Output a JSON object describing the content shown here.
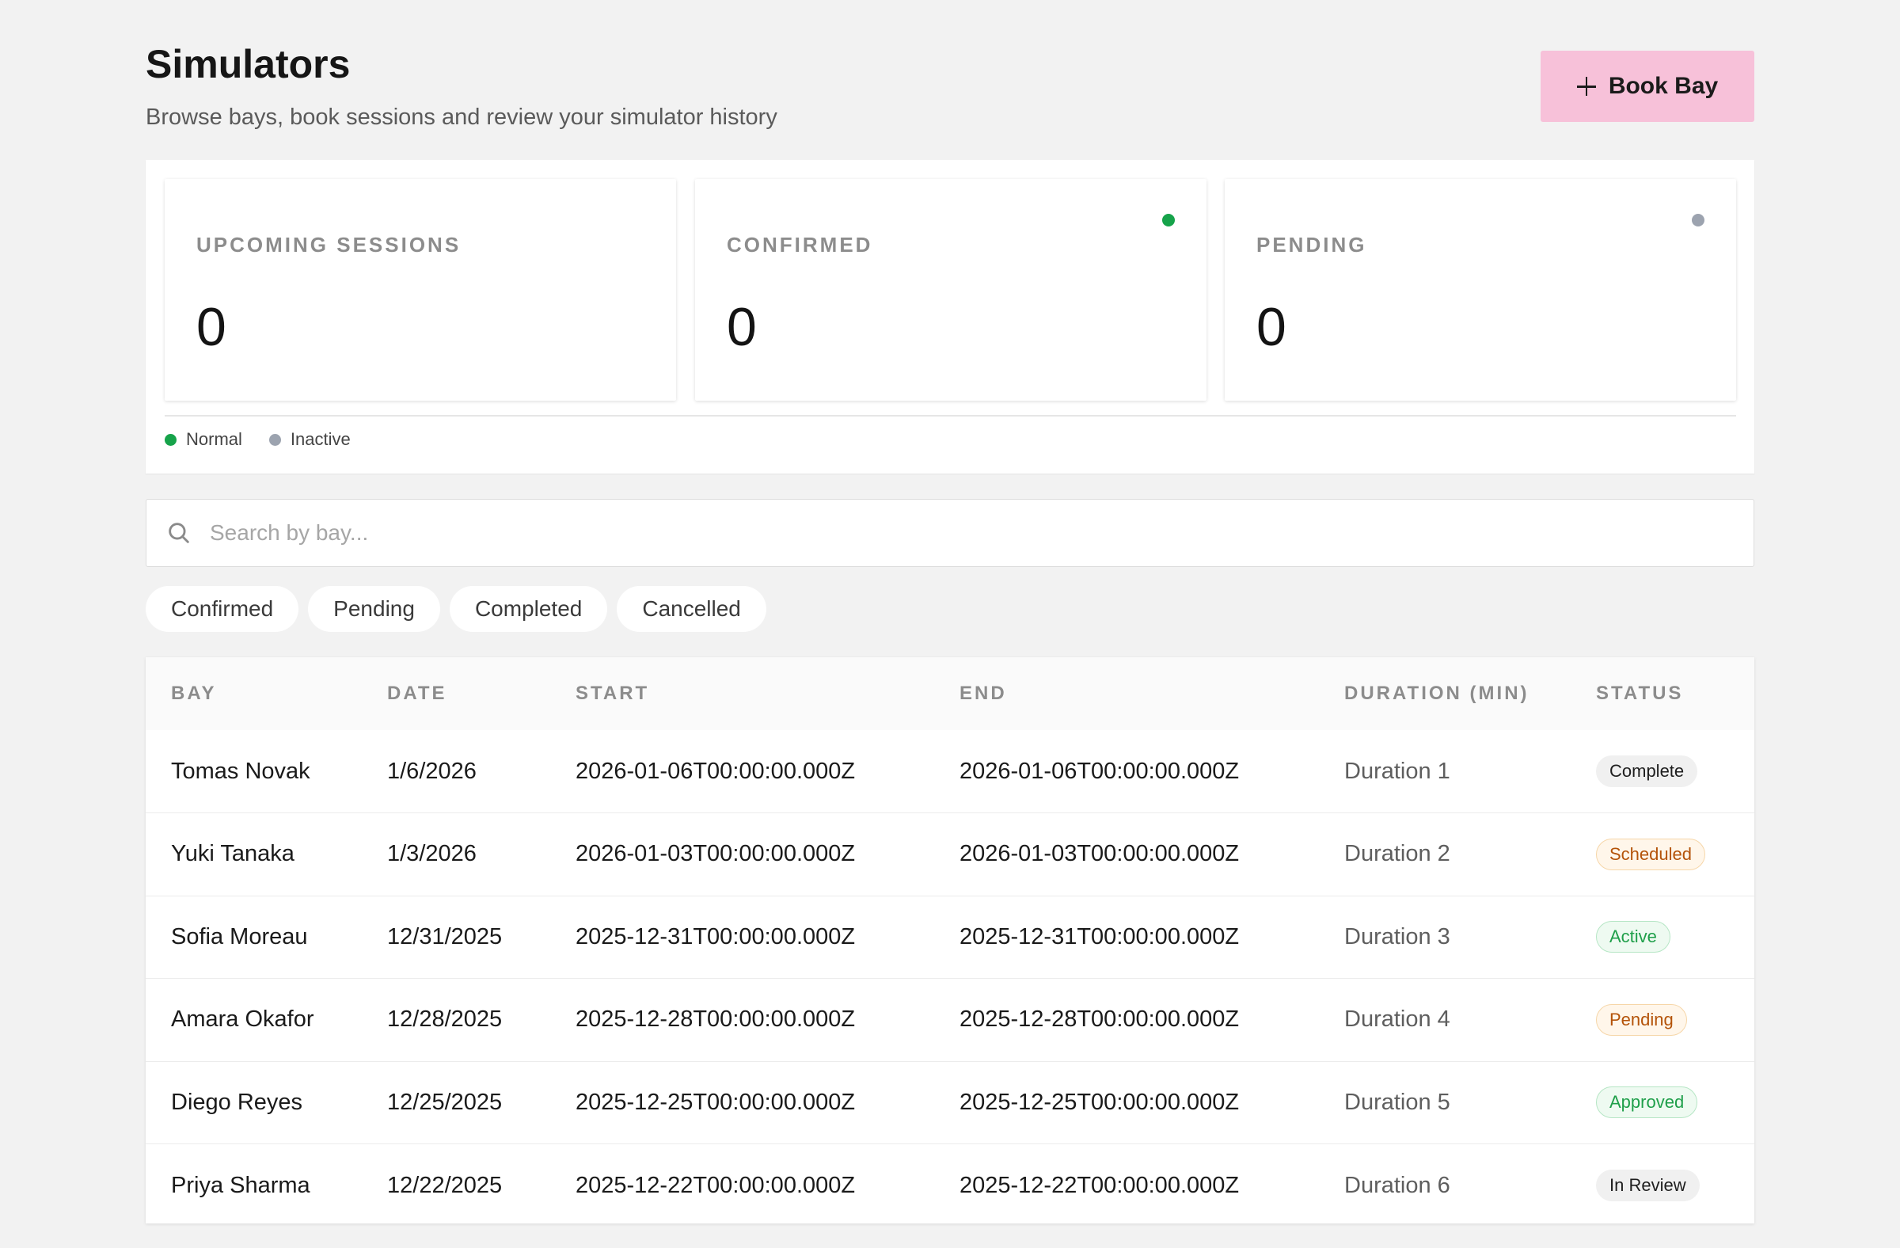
{
  "header": {
    "title": "Simulators",
    "subtitle": "Browse bays, book sessions and review your simulator history",
    "book_label": "Book Bay"
  },
  "stats": [
    {
      "label": "UPCOMING SESSIONS",
      "value": "0",
      "dot_color": ""
    },
    {
      "label": "CONFIRMED",
      "value": "0",
      "dot_color": "#16a34a"
    },
    {
      "label": "PENDING",
      "value": "0",
      "dot_color": "#9ca3af"
    }
  ],
  "legend": [
    {
      "label": "Normal",
      "color": "#16a34a"
    },
    {
      "label": "Inactive",
      "color": "#9ca3af"
    }
  ],
  "search": {
    "placeholder": "Search by bay..."
  },
  "filters": [
    "Confirmed",
    "Pending",
    "Completed",
    "Cancelled"
  ],
  "table": {
    "columns": [
      "BAY",
      "DATE",
      "START",
      "END",
      "DURATION (MIN)",
      "STATUS"
    ],
    "rows": [
      {
        "bay": "Tomas Novak",
        "date": "1/6/2026",
        "start": "2026-01-06T00:00:00.000Z",
        "end": "2026-01-06T00:00:00.000Z",
        "duration": "Duration 1",
        "status": "Complete",
        "status_style": "neutral"
      },
      {
        "bay": "Yuki Tanaka",
        "date": "1/3/2026",
        "start": "2026-01-03T00:00:00.000Z",
        "end": "2026-01-03T00:00:00.000Z",
        "duration": "Duration 2",
        "status": "Scheduled",
        "status_style": "warn"
      },
      {
        "bay": "Sofia Moreau",
        "date": "12/31/2025",
        "start": "2025-12-31T00:00:00.000Z",
        "end": "2025-12-31T00:00:00.000Z",
        "duration": "Duration 3",
        "status": "Active",
        "status_style": "success"
      },
      {
        "bay": "Amara Okafor",
        "date": "12/28/2025",
        "start": "2025-12-28T00:00:00.000Z",
        "end": "2025-12-28T00:00:00.000Z",
        "duration": "Duration 4",
        "status": "Pending",
        "status_style": "warn"
      },
      {
        "bay": "Diego Reyes",
        "date": "12/25/2025",
        "start": "2025-12-25T00:00:00.000Z",
        "end": "2025-12-25T00:00:00.000Z",
        "duration": "Duration 5",
        "status": "Approved",
        "status_style": "success"
      },
      {
        "bay": "Priya Sharma",
        "date": "12/22/2025",
        "start": "2025-12-22T00:00:00.000Z",
        "end": "2025-12-22T00:00:00.000Z",
        "duration": "Duration 6",
        "status": "In Review",
        "status_style": "neutral"
      }
    ]
  },
  "colors": {
    "accent_button": "#f7c1d9",
    "background": "#f2f2f2",
    "success": "#16a34a",
    "inactive": "#9ca3af",
    "warning": "#b45309"
  }
}
